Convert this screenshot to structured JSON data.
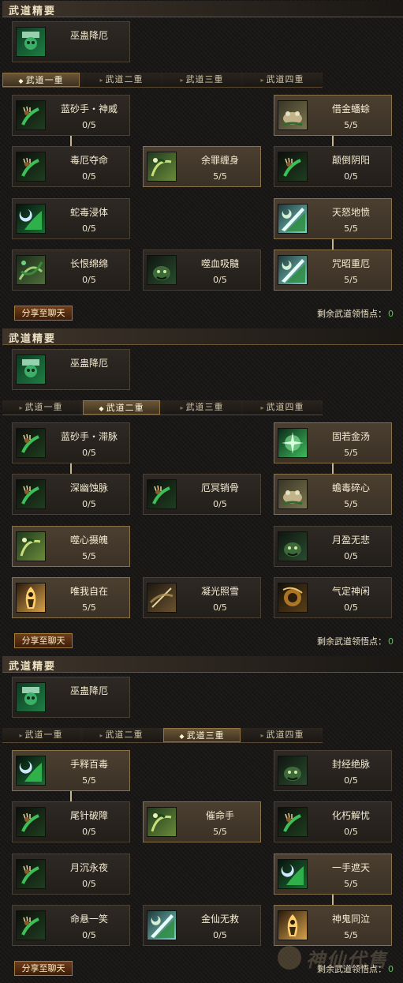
{
  "panels": [
    {
      "header": "武道精要",
      "featured": {
        "name": "巫蛊降厄",
        "icon": "jade-skull-icon"
      },
      "tabs": [
        "武道一重",
        "武道二重",
        "武道三重",
        "武道四重"
      ],
      "active_tab": 0,
      "skills": [
        {
          "name": "蓝砂手・神威",
          "level": "0/5",
          "icon": "claw-hand-icon",
          "mastered": false
        },
        {
          "name": "借金蟠蜍",
          "level": "5/5",
          "icon": "toad-icon",
          "mastered": true
        },
        {
          "name": "毒厄夺命",
          "level": "0/5",
          "icon": "claw-hand-icon",
          "mastered": false
        },
        {
          "name": "余罪缠身",
          "level": "5/5",
          "icon": "serpent-curse-icon",
          "mastered": true
        },
        {
          "name": "颠倒阴阳",
          "level": "0/5",
          "icon": "claw-hand-icon",
          "mastered": false
        },
        {
          "name": "蛇毒浸体",
          "level": "0/5",
          "icon": "moon-blade-icon",
          "mastered": false
        },
        {
          "name": "天怒地愤",
          "level": "5/5",
          "icon": "lightning-blade-icon",
          "mastered": true
        },
        {
          "name": "长恨绵绵",
          "level": "0/5",
          "icon": "vine-wrap-icon",
          "mastered": false
        },
        {
          "name": "噬血吸髓",
          "level": "0/5",
          "icon": "demon-face-icon",
          "mastered": false
        },
        {
          "name": "咒昭重厄",
          "level": "5/5",
          "icon": "lightning-blade-icon",
          "mastered": true
        }
      ],
      "share_label": "分享至聊天",
      "points_label": "剩余武道领悟点：",
      "points_value": "0"
    },
    {
      "header": "武道精要",
      "featured": {
        "name": "巫蛊降厄",
        "icon": "jade-skull-icon"
      },
      "tabs": [
        "武道一重",
        "武道二重",
        "武道三重",
        "武道四重"
      ],
      "active_tab": 1,
      "skills": [
        {
          "name": "蓝砂手・滞脉",
          "level": "0/5",
          "icon": "claw-hand-icon",
          "mastered": false
        },
        {
          "name": "固若金汤",
          "level": "5/5",
          "icon": "green-burst-icon",
          "mastered": true
        },
        {
          "name": "深幽蚀脉",
          "level": "0/5",
          "icon": "claw-hand-icon",
          "mastered": false
        },
        {
          "name": "厄冥销骨",
          "level": "0/5",
          "icon": "claw-hand-icon",
          "mastered": false
        },
        {
          "name": "蟾毒碎心",
          "level": "5/5",
          "icon": "toad-icon",
          "mastered": true
        },
        {
          "name": "噬心摄魄",
          "level": "5/5",
          "icon": "serpent-curse-icon",
          "mastered": true
        },
        {
          "name": "月盈无悲",
          "level": "0/5",
          "icon": "demon-face-icon",
          "mastered": false
        },
        {
          "name": "唯我自在",
          "level": "5/5",
          "icon": "flame-figure-icon",
          "mastered": true
        },
        {
          "name": "凝光照雪",
          "level": "0/5",
          "icon": "sword-aura-icon",
          "mastered": false
        },
        {
          "name": "气定神闲",
          "level": "0/5",
          "icon": "spirit-orb-icon",
          "mastered": false
        }
      ],
      "share_label": "分享至聊天",
      "points_label": "剩余武道领悟点：",
      "points_value": "0"
    },
    {
      "header": "武道精要",
      "featured": {
        "name": "巫蛊降厄",
        "icon": "jade-skull-icon"
      },
      "tabs": [
        "武道一重",
        "武道二重",
        "武道三重",
        "武道四重"
      ],
      "active_tab": 2,
      "skills": [
        {
          "name": "手释百毒",
          "level": "5/5",
          "icon": "moon-blade-icon",
          "mastered": true
        },
        {
          "name": "封经绝脉",
          "level": "0/5",
          "icon": "demon-face-icon",
          "mastered": false
        },
        {
          "name": "尾针破障",
          "level": "0/5",
          "icon": "claw-hand-icon",
          "mastered": false
        },
        {
          "name": "催命手",
          "level": "5/5",
          "icon": "serpent-curse-icon",
          "mastered": true
        },
        {
          "name": "化朽解忧",
          "level": "0/5",
          "icon": "claw-hand-icon",
          "mastered": false
        },
        {
          "name": "月沉永夜",
          "level": "0/5",
          "icon": "claw-hand-icon",
          "mastered": false
        },
        {
          "name": "一手遮天",
          "level": "5/5",
          "icon": "moon-blade-icon",
          "mastered": true
        },
        {
          "name": "命悬一笑",
          "level": "0/5",
          "icon": "claw-hand-icon",
          "mastered": false
        },
        {
          "name": "金仙无救",
          "level": "0/5",
          "icon": "lightning-blade-icon",
          "mastered": false
        },
        {
          "name": "神鬼同泣",
          "level": "5/5",
          "icon": "flame-figure-icon",
          "mastered": true
        }
      ],
      "share_label": "分享至聊天",
      "points_label": "剩余武道领悟点：",
      "points_value": "0"
    }
  ],
  "watermark": {
    "text": "神仙代售",
    "icon": "mascot-icon"
  }
}
